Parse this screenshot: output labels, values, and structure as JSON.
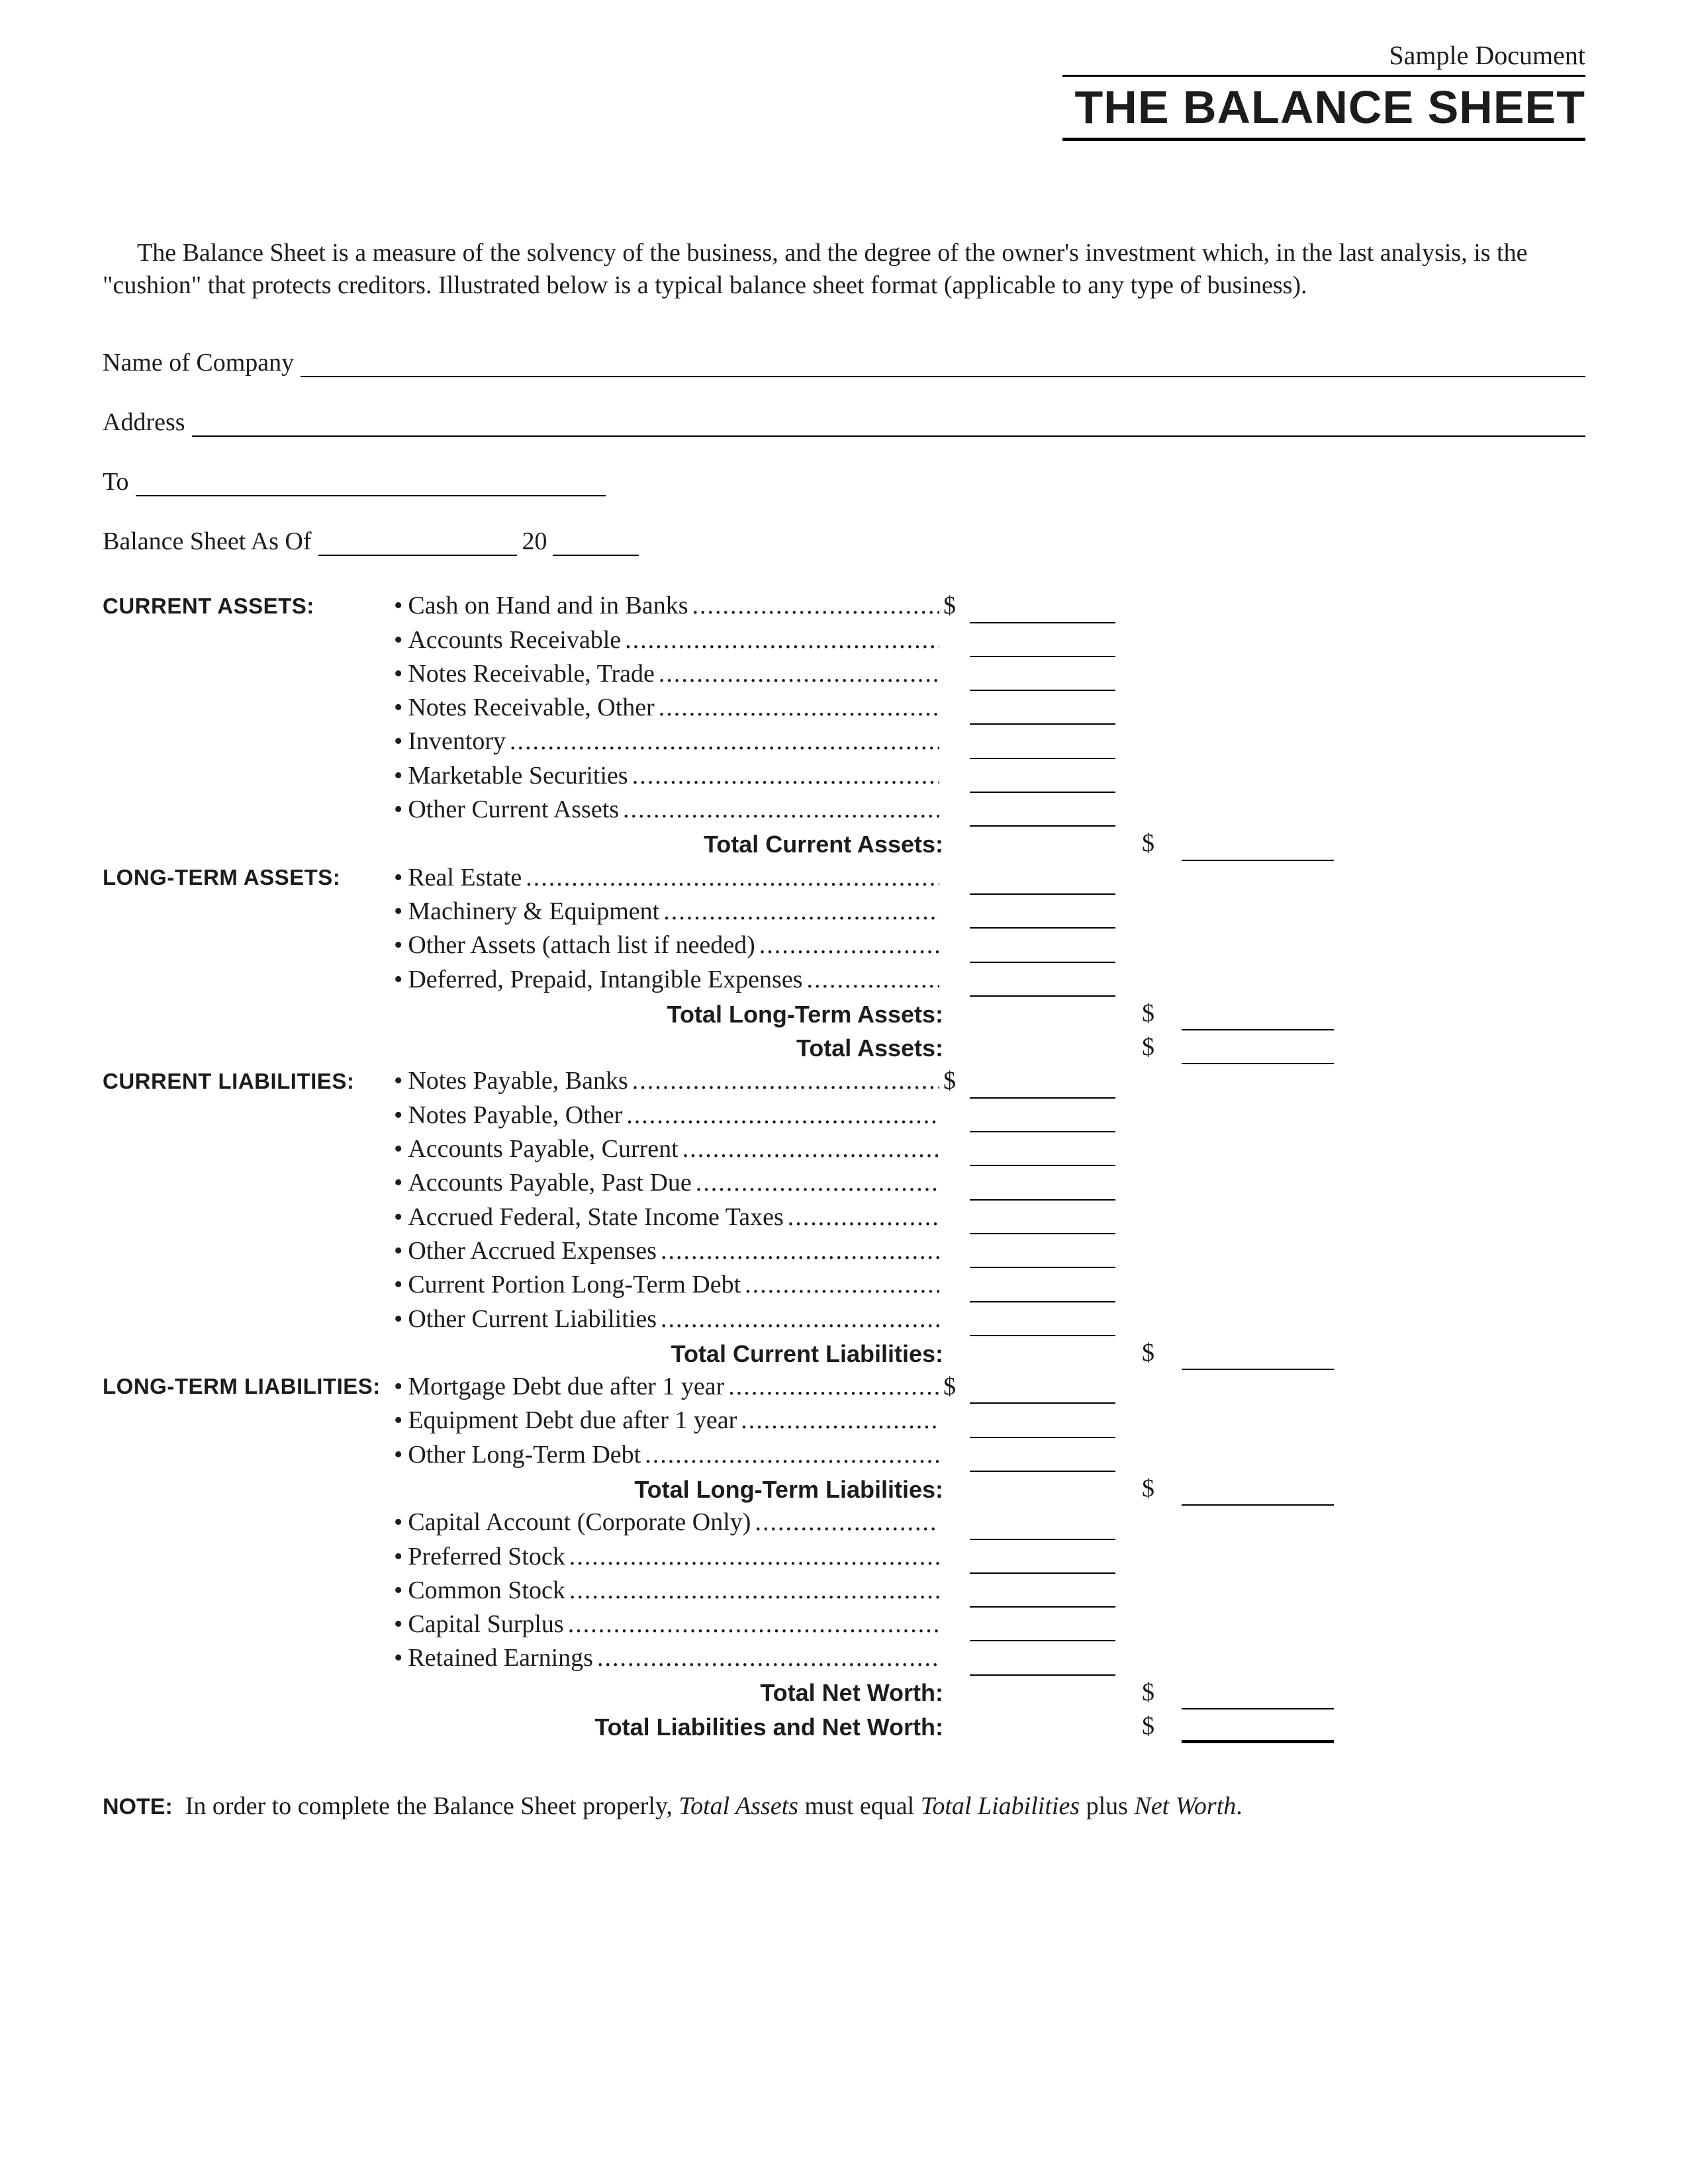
{
  "header": {
    "sample": "Sample Document",
    "title": "THE BALANCE SHEET"
  },
  "intro": "The Balance Sheet is a measure of the solvency of the business, and the degree of the owner's investment which, in the last analysis, is the \"cushion\" that protects creditors. Illustrated below is a typical balance sheet format (applicable to any type of business).",
  "form": {
    "name_label": "Name of Company",
    "address_label": "Address",
    "to_label": "To",
    "asof_label": "Balance Sheet As Of",
    "year_prefix": "20"
  },
  "sections": {
    "current_assets": {
      "heading": "CURRENT ASSETS:",
      "items": [
        "Cash on Hand and in Banks",
        "Accounts Receivable",
        "Notes Receivable, Trade",
        "Notes Receivable, Other",
        "Inventory",
        "Marketable Securities",
        "Other Current Assets"
      ],
      "total": "Total Current Assets:"
    },
    "long_term_assets": {
      "heading": "LONG-TERM ASSETS:",
      "items": [
        "Real Estate",
        "Machinery & Equipment",
        "Other Assets (attach list if needed)",
        "Deferred, Prepaid, Intangible Expenses"
      ],
      "total": "Total Long-Term Assets:",
      "grand_total": "Total Assets:"
    },
    "current_liabilities": {
      "heading": "CURRENT LIABILITIES:",
      "items": [
        "Notes Payable, Banks",
        "Notes Payable, Other",
        "Accounts Payable, Current",
        "Accounts Payable, Past Due",
        "Accrued Federal, State Income Taxes",
        "Other Accrued Expenses",
        "Current Portion Long-Term Debt",
        "Other Current Liabilities"
      ],
      "total": "Total Current Liabilities:"
    },
    "long_term_liabilities": {
      "heading": "LONG-TERM LIABILITIES:",
      "items": [
        "Mortgage Debt due after 1 year",
        "Equipment Debt due after 1 year",
        "Other Long-Term Debt"
      ],
      "total": "Total Long-Term Liabilities:"
    },
    "equity": {
      "items": [
        "Capital Account (Corporate Only)",
        "Preferred Stock",
        "Common Stock",
        "Capital Surplus",
        "Retained Earnings"
      ],
      "total1": "Total Net Worth:",
      "total2": "Total Liabilities and Net Worth:"
    }
  },
  "note": {
    "prefix": "NOTE:",
    "t1": "In order to complete the Balance Sheet properly, ",
    "i1": "Total Assets",
    "t2": " must equal ",
    "i2": "Total Liabilities",
    "t3": " plus ",
    "i3": "Net Worth",
    "t4": "."
  },
  "dollar": "$",
  "leader": "................................................................................................................"
}
